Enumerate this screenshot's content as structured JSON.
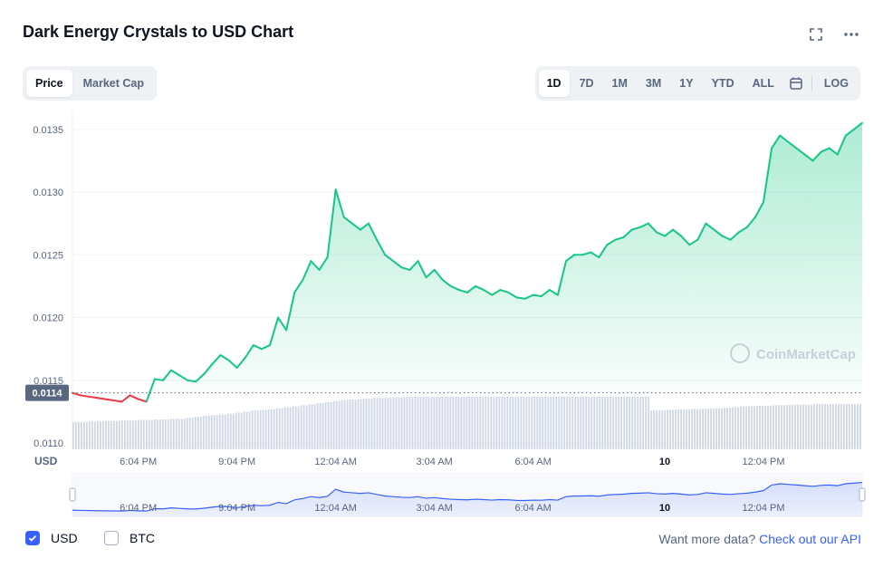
{
  "header": {
    "title": "Dark Energy Crystals to USD Chart",
    "fullscreen_icon": "fullscreen-icon",
    "more_icon": "more-dots-icon"
  },
  "toggle": {
    "price": "Price",
    "market_cap": "Market Cap",
    "active": "Price"
  },
  "ranges": {
    "items": [
      "1D",
      "7D",
      "1M",
      "3M",
      "1Y",
      "YTD",
      "ALL"
    ],
    "active": "1D",
    "calendar_icon": "calendar-icon",
    "log": "LOG"
  },
  "footer": {
    "usd_label": "USD",
    "btc_label": "BTC",
    "usd_checked": true,
    "btc_checked": false,
    "api_text": "Want more data?",
    "api_link": "Check out our API"
  },
  "watermark": "CoinMarketCap",
  "colors": {
    "up": "#16c784",
    "down": "#ea3943",
    "accent": "#3861fb",
    "volume": "#cfd6e4"
  },
  "chart_data": {
    "type": "line",
    "y_axis_label": "USD",
    "yticks": [
      "0.0135",
      "0.0130",
      "0.0125",
      "0.0120",
      "0.0115",
      "0.0110"
    ],
    "ytick_values": [
      0.0135,
      0.013,
      0.0125,
      0.012,
      0.0115,
      0.011
    ],
    "ylim": [
      0.01095,
      0.01365
    ],
    "xticks": [
      "6:04 PM",
      "9:04 PM",
      "12:04 AM",
      "3:04 AM",
      "6:04 AM",
      "10",
      "12:04 PM"
    ],
    "xtick_hours": [
      2,
      5,
      8,
      11,
      14,
      18,
      21
    ],
    "x_range_hours": [
      0,
      24
    ],
    "reference_price": 0.0114,
    "reference_label": "0.0114",
    "price_hours": [
      0,
      0.25,
      0.5,
      0.75,
      1,
      1.25,
      1.5,
      1.75,
      2,
      2.25,
      2.5,
      2.75,
      3,
      3.25,
      3.5,
      3.75,
      4,
      4.25,
      4.5,
      4.75,
      5,
      5.25,
      5.5,
      5.75,
      6,
      6.25,
      6.5,
      6.75,
      7,
      7.25,
      7.5,
      7.75,
      8,
      8.25,
      8.5,
      8.75,
      9,
      9.25,
      9.5,
      9.75,
      10,
      10.25,
      10.5,
      10.75,
      11,
      11.25,
      11.5,
      11.75,
      12,
      12.25,
      12.5,
      12.75,
      13,
      13.25,
      13.5,
      13.75,
      14,
      14.25,
      14.5,
      14.75,
      15,
      15.25,
      15.5,
      15.75,
      16,
      16.25,
      16.5,
      16.75,
      17,
      17.25,
      17.5,
      17.75,
      18,
      18.25,
      18.5,
      18.75,
      19,
      19.25,
      19.5,
      19.75,
      20,
      20.25,
      20.5,
      20.75,
      21,
      21.25,
      21.5,
      21.75,
      22,
      22.25,
      22.5,
      22.75,
      23,
      23.25,
      23.5,
      23.75,
      24
    ],
    "price_values": [
      0.0114,
      0.01138,
      0.01137,
      0.01136,
      0.01135,
      0.01134,
      0.01133,
      0.01138,
      0.01135,
      0.01133,
      0.01151,
      0.0115,
      0.01158,
      0.01154,
      0.0115,
      0.01149,
      0.01155,
      0.01163,
      0.0117,
      0.01166,
      0.0116,
      0.01168,
      0.01178,
      0.01175,
      0.01178,
      0.012,
      0.0119,
      0.0122,
      0.0123,
      0.01245,
      0.01238,
      0.01248,
      0.01302,
      0.0128,
      0.01275,
      0.0127,
      0.01275,
      0.01262,
      0.0125,
      0.01245,
      0.0124,
      0.01238,
      0.01245,
      0.01232,
      0.01238,
      0.0123,
      0.01225,
      0.01222,
      0.0122,
      0.01225,
      0.01222,
      0.01218,
      0.01222,
      0.0122,
      0.01216,
      0.01215,
      0.01218,
      0.01217,
      0.01222,
      0.01218,
      0.01245,
      0.0125,
      0.0125,
      0.01252,
      0.01248,
      0.01258,
      0.01262,
      0.01264,
      0.0127,
      0.01272,
      0.01275,
      0.01268,
      0.01265,
      0.0127,
      0.01265,
      0.01258,
      0.01262,
      0.01275,
      0.0127,
      0.01265,
      0.01262,
      0.01268,
      0.01272,
      0.0128,
      0.01292,
      0.01335,
      0.01345,
      0.0134,
      0.01335,
      0.0133,
      0.01325,
      0.01332,
      0.01335,
      0.0133,
      0.01345,
      0.0135,
      0.01355
    ],
    "volume_relative": [
      0.52,
      0.52,
      0.53,
      0.53,
      0.54,
      0.54,
      0.55,
      0.55,
      0.56,
      0.56,
      0.57,
      0.57,
      0.58,
      0.58,
      0.6,
      0.62,
      0.64,
      0.65,
      0.66,
      0.68,
      0.7,
      0.72,
      0.74,
      0.75,
      0.76,
      0.78,
      0.8,
      0.82,
      0.84,
      0.86,
      0.88,
      0.9,
      0.92,
      0.94,
      0.95,
      0.96,
      0.97,
      0.98,
      0.98,
      0.99,
      0.99,
      1.0,
      1.0,
      1.0,
      1.0,
      1.0,
      1.0,
      1.0,
      1.0,
      1.0,
      1.0,
      1.0,
      1.0,
      1.0,
      1.0,
      1.0,
      1.0,
      1.0,
      1.0,
      1.0,
      1.0,
      1.0,
      1.0,
      1.0,
      1.0,
      1.0,
      1.0,
      1.0,
      1.0,
      1.0,
      1.0,
      0.74,
      0.74,
      0.75,
      0.76,
      0.76,
      0.77,
      0.77,
      0.78,
      0.78,
      0.79,
      0.8,
      0.81,
      0.82,
      0.83,
      0.83,
      0.84,
      0.84,
      0.85,
      0.85,
      0.85,
      0.86,
      0.86,
      0.86,
      0.86,
      0.86,
      0.86
    ]
  }
}
